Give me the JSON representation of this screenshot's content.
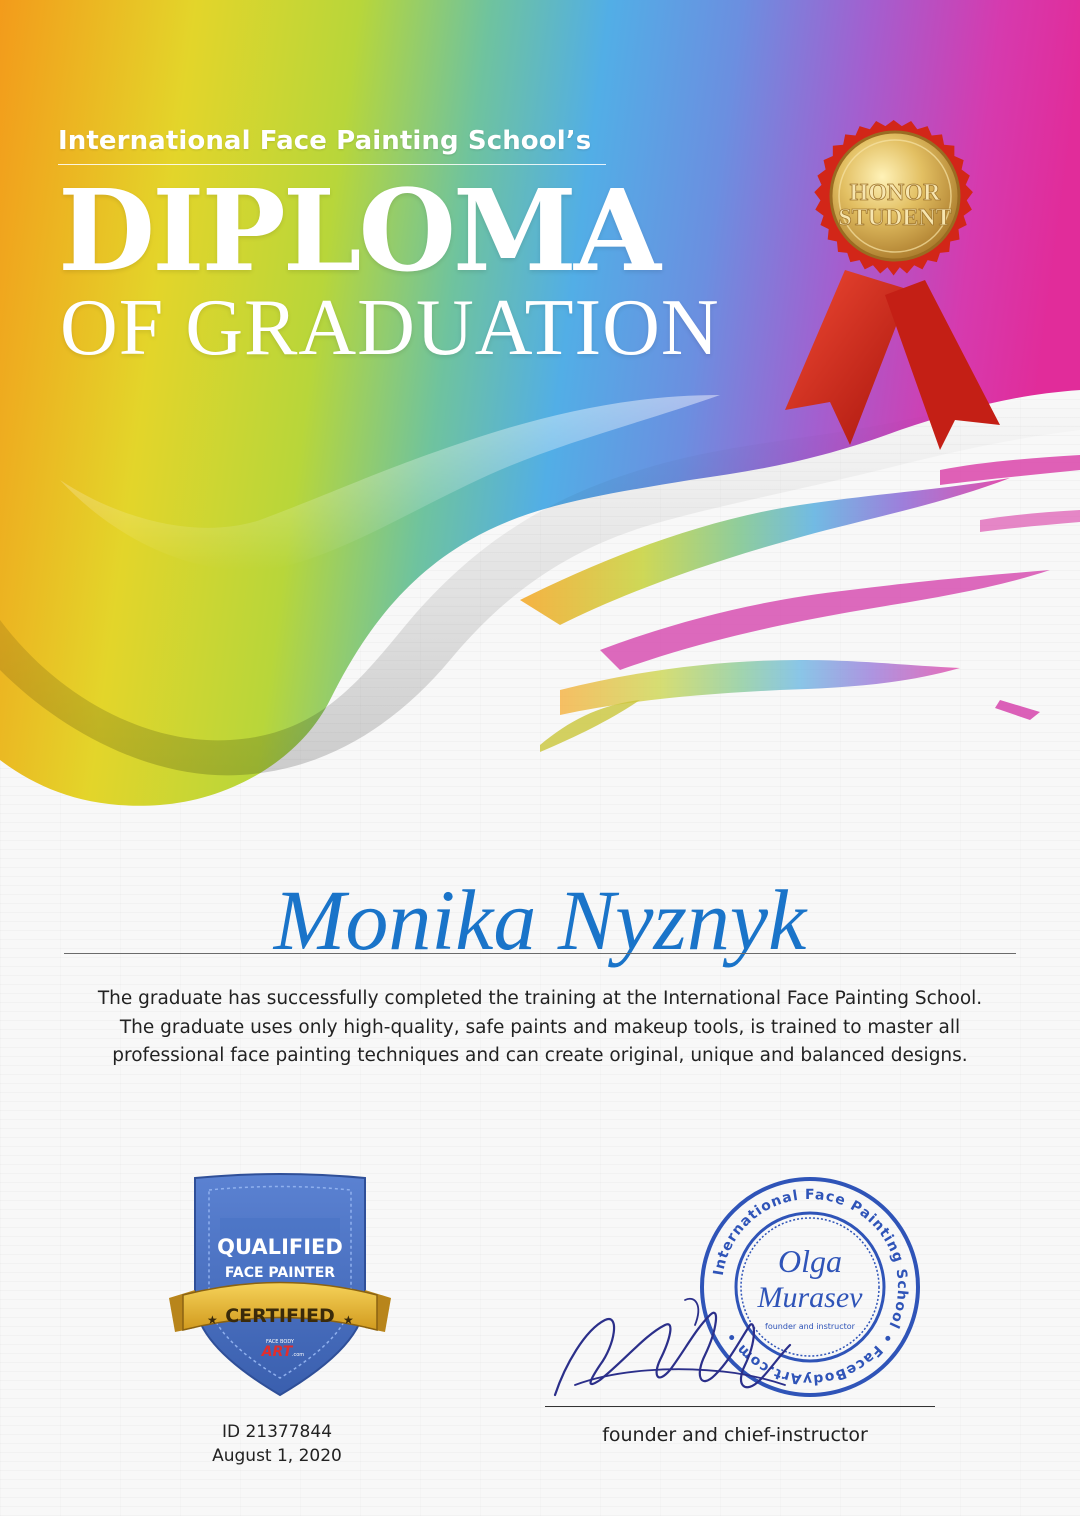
{
  "header": {
    "school_title": "International Face Painting School’s",
    "title": "DIPLOMA",
    "subtitle": "OF GRADUATION"
  },
  "medal": {
    "line1": "HONOR",
    "line2": "STUDENT"
  },
  "graduate": {
    "name": "Monika Nyznyk"
  },
  "description": {
    "line1": "The graduate has successfully completed the training at the International Face Painting School.",
    "line2": "The graduate uses only high-quality, safe paints and makeup tools, is trained to master all",
    "line3": "professional face painting techniques and can create original, unique and balanced designs."
  },
  "badge": {
    "line1": "QUALIFIED",
    "line2": "FACE PAINTER",
    "ribbon": "CERTIFIED",
    "logo_small": "FACE BODY",
    "logo": "ART",
    "logo_suffix": ".com"
  },
  "certificate": {
    "id": "ID 21377844",
    "date": "August 1, 2020"
  },
  "stamp": {
    "ring_text": "International Face Painting School • FaceBodyArt.com •",
    "name_line1": "Olga",
    "name_line2": "Murasev",
    "role": "founder and instructor"
  },
  "signature": {
    "caption": "founder and chief-instructor"
  },
  "colors": {
    "name_blue": "#1a74c9",
    "medal_gold": "#d8b25a",
    "ribbon_red": "#d8281c",
    "badge_blue": "#3f67b8",
    "badge_gold": "#e5b637",
    "stamp_blue": "#2f54b8"
  }
}
